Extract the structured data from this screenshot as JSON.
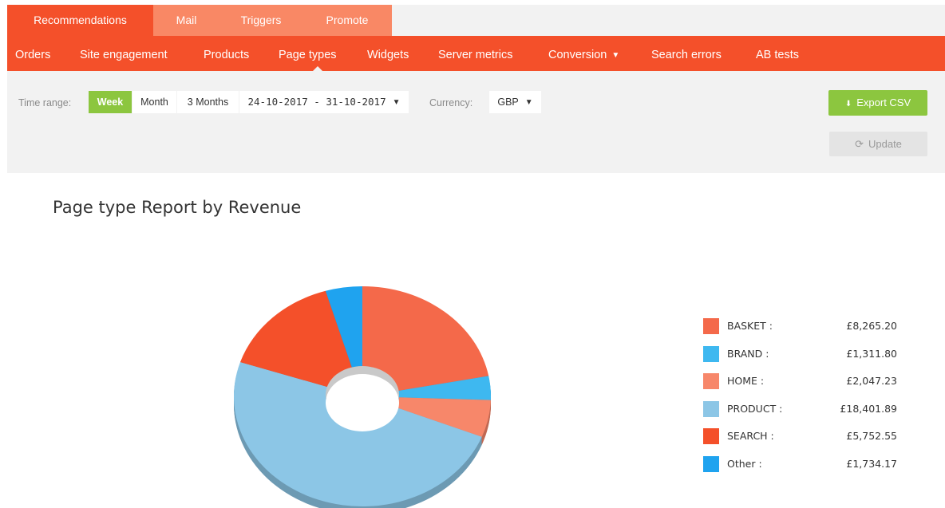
{
  "top_tabs": [
    "Recommendations",
    "Mail",
    "Triggers",
    "Promote"
  ],
  "subnav": {
    "items": [
      "Orders",
      "Site engagement",
      "Products",
      "Page types",
      "Widgets",
      "Server metrics",
      "Conversion",
      "Search errors",
      "AB tests"
    ],
    "active": "Page types"
  },
  "filters": {
    "time_range_label": "Time range:",
    "ranges": [
      "Week",
      "Month",
      "3 Months"
    ],
    "active_range": "Week",
    "date_range": "24-10-2017 - 31-10-2017",
    "currency_label": "Currency:",
    "currency": "GBP",
    "export_label": "Export CSV",
    "update_label": "Update"
  },
  "chart_data": {
    "type": "pie",
    "title": "Page type Report by Revenue",
    "style": "3D donut",
    "slices": [
      {
        "label": "BASKET",
        "display": "£8,265.20",
        "value": 8265.2,
        "color": "#f4694a"
      },
      {
        "label": "BRAND",
        "display": "£1,311.80",
        "value": 1311.8,
        "color": "#3eb8f0"
      },
      {
        "label": "HOME",
        "display": "£2,047.23",
        "value": 2047.23,
        "color": "#f7876a"
      },
      {
        "label": "PRODUCT",
        "display": "£18,401.89",
        "value": 18401.89,
        "color": "#8cc6e6"
      },
      {
        "label": "SEARCH",
        "display": "£5,752.55",
        "value": 5752.55,
        "color": "#f4502a"
      },
      {
        "label": "Other",
        "display": "£1,734.17",
        "value": 1734.17,
        "color": "#1fa3ef"
      }
    ],
    "legend_position": "right"
  }
}
